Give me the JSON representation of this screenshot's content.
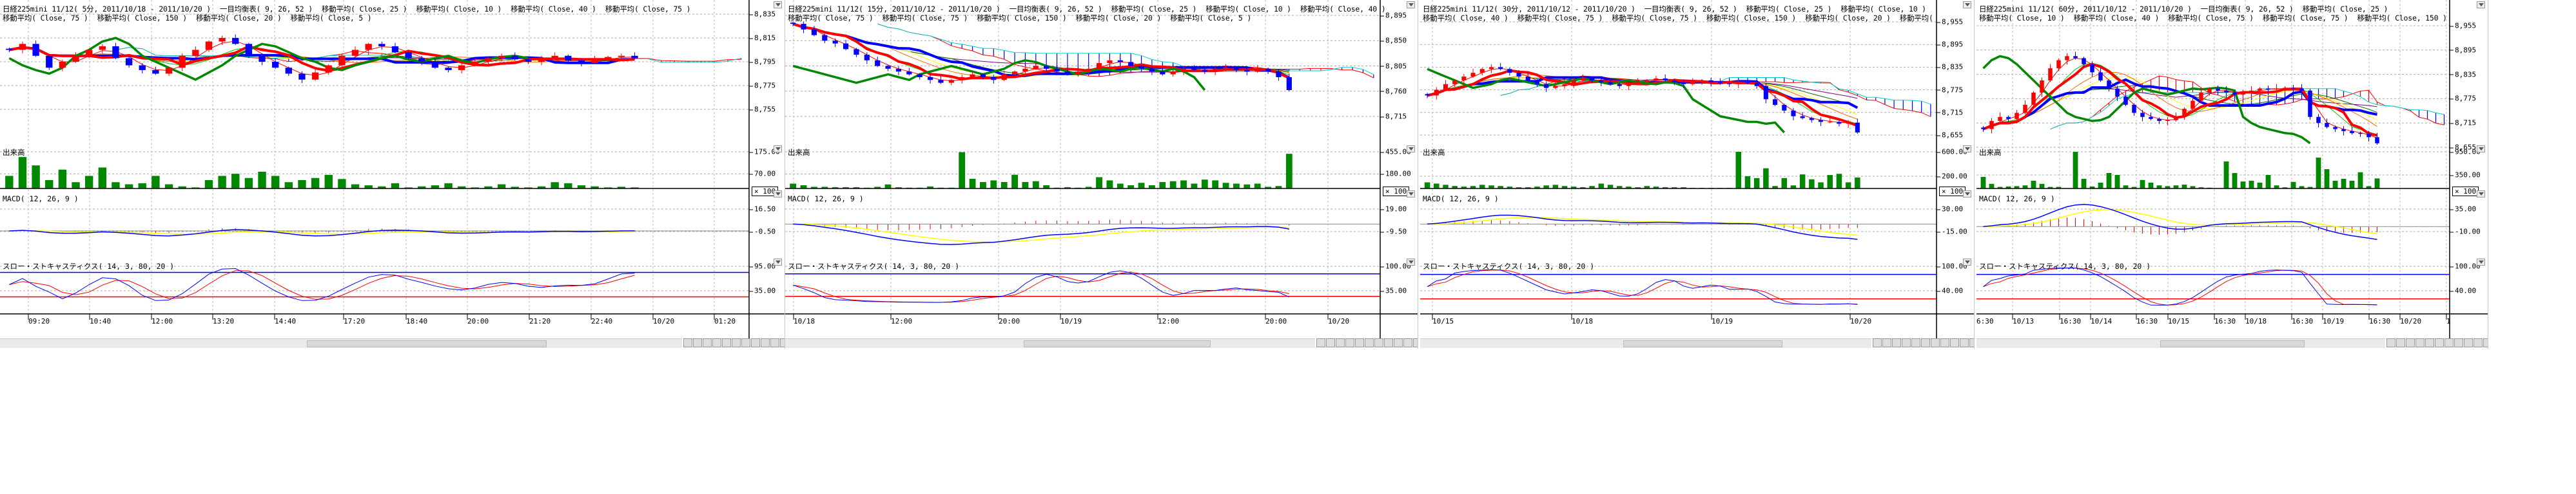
{
  "colors": {
    "up": "#ff0000",
    "down": "#0000ff",
    "volume": "#008800",
    "tenkan": "#ff0000",
    "kijun": "#0000ff",
    "chikou": "#008800",
    "cloud_up": "#ff0000",
    "cloud_down": "#0000ff",
    "ma5": "#ff0000",
    "ma10": "#00cc00",
    "ma20": "#ff6600",
    "ma25": "#ffff00",
    "ma40": "#006600",
    "ma75": "#800080",
    "span_b": "#00cccc",
    "macd": "#0000ff",
    "signal": "#ffff00",
    "hist": "#ff0000",
    "stoch_k": "#0000ff",
    "stoch_d": "#ff0000",
    "level_high": "#0000ff",
    "level_low": "#ff0000"
  },
  "labels": {
    "volume": "出来高",
    "macd": "MACD( 12, 26, 9 )",
    "stoch": "スロー・ストキャスティクス( 14, 3, 80, 20 )",
    "volume_unit": "× 100"
  },
  "panels": [
    {
      "title_line1": [
        "日経225mini 11/12( 5分, 2011/10/18 - 2011/10/20 )",
        "一目均衡表( 9, 26, 52 )",
        "移動平均( Close, 25 )",
        "移動平均( Close, 10 )",
        "移動平均( Close, 40 )",
        "移動平均( Close, 75 )"
      ],
      "title_line2": [
        "移動平均( Close, 75 )",
        "移動平均( Close, 150 )",
        "移動平均( Close, 20 )",
        "移動平均( Close, 5 )"
      ],
      "price_ticks": [
        "8,835",
        "8,815",
        "8,795",
        "8,775",
        "8,755"
      ],
      "price_tick_values": [
        8835,
        8815,
        8795,
        8775,
        8755
      ],
      "volume_ticks": [
        "175.00",
        "70.00"
      ],
      "volume_tick_values": [
        175,
        70
      ],
      "macd_ticks": [
        "16.50",
        "-0.50"
      ],
      "macd_tick_values": [
        16.5,
        -0.5
      ],
      "stoch_ticks": [
        "95.00",
        "35.00"
      ],
      "stoch_tick_values": [
        95,
        35
      ],
      "x_labels": [
        "09:20",
        "10:40",
        "12:00",
        "13:20",
        "14:40",
        "17:20",
        "18:40",
        "20:00",
        "21:20",
        "22:40",
        "10/20",
        "01:20"
      ],
      "close": [
        8805,
        8810,
        8800,
        8790,
        8795,
        8800,
        8805,
        8808,
        8798,
        8792,
        8788,
        8785,
        8790,
        8800,
        8805,
        8812,
        8815,
        8810,
        8800,
        8795,
        8790,
        8785,
        8780,
        8786,
        8792,
        8800,
        8805,
        8810,
        8808,
        8803,
        8798,
        8795,
        8790,
        8788,
        8792,
        8795,
        8798,
        8800,
        8797,
        8795,
        8798,
        8800,
        8796,
        8794,
        8797,
        8799,
        8800,
        8798
      ],
      "volume": [
        60,
        150,
        110,
        40,
        90,
        30,
        60,
        100,
        30,
        20,
        25,
        60,
        20,
        10,
        5,
        40,
        60,
        70,
        50,
        80,
        60,
        30,
        40,
        50,
        65,
        45,
        20,
        15,
        10,
        25,
        5,
        10,
        15,
        25,
        10,
        5,
        10,
        20,
        8,
        5,
        10,
        30,
        25,
        15,
        10,
        5,
        8,
        5
      ]
    },
    {
      "title_line1": [
        "日経225mini 11/12( 15分, 2011/10/12 - 2011/10/20 )",
        "一目均衡表( 9, 26, 52 )",
        "移動平均( Close, 25 )",
        "移動平均( Close, 10 )",
        "移動平均( Close, 40 )"
      ],
      "title_line2": [
        "移動平均( Close, 75 )",
        "移動平均( Close, 75 )",
        "移動平均( Close, 150 )",
        "移動平均( Close, 20 )",
        "移動平均( Close, 5 )"
      ],
      "price_ticks": [
        "8,895",
        "8,850",
        "8,805",
        "8,760",
        "8,715"
      ],
      "price_tick_values": [
        8895,
        8850,
        8805,
        8760,
        8715
      ],
      "volume_ticks": [
        "455.00",
        "180.00"
      ],
      "volume_tick_values": [
        455,
        180
      ],
      "macd_ticks": [
        "19.00",
        "-9.50"
      ],
      "macd_tick_values": [
        19,
        -9.5
      ],
      "stoch_ticks": [
        "100.00",
        "35.00"
      ],
      "stoch_tick_values": [
        100,
        35
      ],
      "x_labels": [
        "10/18",
        "12:00",
        "20:00",
        "10/19",
        "12:00",
        "20:00",
        "10/20"
      ],
      "close": [
        8880,
        8870,
        8860,
        8850,
        8845,
        8835,
        8825,
        8815,
        8805,
        8800,
        8795,
        8790,
        8785,
        8780,
        8775,
        8780,
        8785,
        8790,
        8785,
        8780,
        8790,
        8795,
        8800,
        8805,
        8800,
        8795,
        8790,
        8795,
        8800,
        8810,
        8815,
        8812,
        8805,
        8800,
        8795,
        8790,
        8795,
        8800,
        8798,
        8795,
        8800,
        8802,
        8798,
        8795,
        8800,
        8795,
        8785,
        8762
      ],
      "volume": [
        60,
        40,
        20,
        20,
        15,
        15,
        15,
        10,
        20,
        50,
        15,
        10,
        10,
        25,
        10,
        10,
        450,
        120,
        80,
        100,
        80,
        170,
        80,
        90,
        40,
        10,
        15,
        10,
        20,
        140,
        100,
        60,
        40,
        70,
        40,
        80,
        90,
        100,
        60,
        110,
        100,
        70,
        60,
        50,
        60,
        20,
        30,
        430
      ]
    },
    {
      "title_line1": [
        "日経225mini 11/12( 30分, 2011/10/12 - 2011/10/20 )",
        "一目均衡表( 9, 26, 52 )",
        "移動平均( Close, 25 )",
        "移動平均( Close, 10 )"
      ],
      "title_line2": [
        "移動平均( Close, 40 )",
        "移動平均( Close, 75 )",
        "移動平均( Close, 75 )",
        "移動平均( Close, 150 )",
        "移動平均( Close, 20 )",
        "移動平均("
      ],
      "price_ticks": [
        "8,955",
        "8,895",
        "8,835",
        "8,775",
        "8,715",
        "8,655"
      ],
      "price_tick_values": [
        8955,
        8895,
        8835,
        8775,
        8715,
        8655
      ],
      "volume_ticks": [
        "600.00",
        "200.00"
      ],
      "volume_tick_values": [
        600,
        200
      ],
      "macd_ticks": [
        "30.00",
        "-15.00"
      ],
      "macd_tick_values": [
        30,
        -15
      ],
      "stoch_ticks": [
        "100.00",
        "40.00"
      ],
      "stoch_tick_values": [
        100,
        40
      ],
      "x_labels": [
        "10/15",
        "10/18",
        "10/19",
        "10/20"
      ],
      "close": [
        8760,
        8775,
        8790,
        8800,
        8810,
        8820,
        8830,
        8835,
        8830,
        8820,
        8810,
        8800,
        8790,
        8780,
        8785,
        8790,
        8800,
        8805,
        8800,
        8795,
        8790,
        8785,
        8790,
        8795,
        8800,
        8805,
        8800,
        8795,
        8790,
        8795,
        8800,
        8795,
        8792,
        8790,
        8795,
        8793,
        8785,
        8750,
        8735,
        8720,
        8705,
        8700,
        8695,
        8690,
        8690,
        8685,
        8688,
        8662
      ],
      "volume": [
        100,
        80,
        60,
        40,
        30,
        40,
        60,
        50,
        40,
        30,
        20,
        20,
        30,
        50,
        60,
        40,
        30,
        20,
        40,
        80,
        60,
        40,
        30,
        20,
        40,
        30,
        20,
        20,
        20,
        10,
        10,
        10,
        10,
        10,
        600,
        200,
        170,
        330,
        40,
        170,
        50,
        230,
        150,
        100,
        220,
        240,
        100,
        180
      ]
    },
    {
      "title_line1": [
        "日経225mini 11/12( 60分, 2011/10/12 - 2011/10/20 )",
        "一目均衡表( 9, 26, 52 )",
        "移動平均( Close, 25 )"
      ],
      "title_line2": [
        "移動平均( Close, 10 )",
        "移動平均( Close, 40 )",
        "移動平均( Close, 75 )",
        "移動平均( Close, 75 )",
        "移動平均( Close, 150 )"
      ],
      "price_ticks": [
        "8,955",
        "8,895",
        "8,835",
        "8,775",
        "8,715",
        "8,655"
      ],
      "price_tick_values": [
        8955,
        8895,
        8835,
        8775,
        8715,
        8655
      ],
      "volume_ticks": [
        "950.00",
        "350.00"
      ],
      "volume_tick_values": [
        950,
        350
      ],
      "macd_ticks": [
        "35.00",
        "-10.00"
      ],
      "macd_tick_values": [
        35,
        -10
      ],
      "stoch_ticks": [
        "100.00",
        "40.00"
      ],
      "stoch_tick_values": [
        100,
        40
      ],
      "x_labels": [
        "6:30",
        "10/13",
        "16:30",
        "10/14",
        "16:30",
        "10/15",
        "16:30",
        "10/18",
        "16:30",
        "10/19",
        "16:30",
        "10/20",
        "1"
      ],
      "close": [
        8700,
        8720,
        8730,
        8725,
        8740,
        8760,
        8790,
        8820,
        8850,
        8870,
        8880,
        8875,
        8860,
        8840,
        8820,
        8800,
        8780,
        8760,
        8740,
        8730,
        8725,
        8720,
        8722,
        8730,
        8750,
        8770,
        8790,
        8800,
        8795,
        8790,
        8785,
        8790,
        8795,
        8800,
        8798,
        8800,
        8802,
        8800,
        8795,
        8730,
        8715,
        8705,
        8700,
        8695,
        8690,
        8688,
        8680,
        8665
      ],
      "volume": [
        300,
        120,
        40,
        50,
        60,
        80,
        200,
        120,
        40,
        40,
        10,
        950,
        250,
        50,
        150,
        400,
        350,
        80,
        40,
        220,
        150,
        80,
        60,
        80,
        100,
        60,
        30,
        20,
        10,
        700,
        400,
        180,
        200,
        150,
        350,
        80,
        30,
        170,
        60,
        40,
        800,
        500,
        200,
        250,
        200,
        420,
        60,
        260
      ]
    }
  ]
}
